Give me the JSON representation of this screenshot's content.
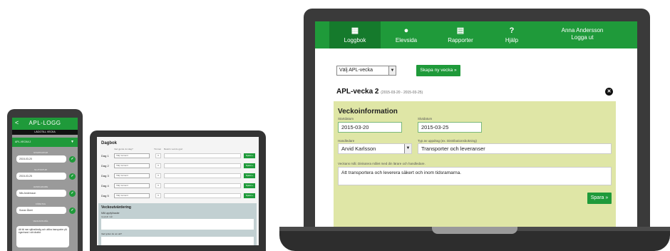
{
  "laptop": {
    "nav": [
      {
        "icon": "calendar-icon",
        "glyph": "▦",
        "label": "Loggbok"
      },
      {
        "icon": "user-icon",
        "glyph": "●",
        "label": "Elevsida"
      },
      {
        "icon": "report-icon",
        "glyph": "▤",
        "label": "Rapporter"
      },
      {
        "icon": "help-icon",
        "glyph": "?",
        "label": "Hjälp"
      }
    ],
    "user_name": "Anna Andersson",
    "logout": "Logga ut",
    "select_week": "Välj APL-vecka",
    "new_week_button": "Skapa ny vecka »",
    "week_title": "APL-vecka 2",
    "week_dates": "(2015-03-20 - 2015-03-25)",
    "panel_title": "Veckoinformation",
    "start_label": "Startdatum",
    "start_value": "2015-03-20",
    "end_label": "Slutdatum",
    "end_value": "2015-03-25",
    "supervisor_label": "Handledare",
    "supervisor_value": "Arvid Karlsson",
    "task_label": "Typ av uppdrag (ex. Distributionsbokning)",
    "task_value": "Transporter och leveranser",
    "goal_label": "Veckans mål. Diskutera målet med din lärare och handledare.",
    "goal_value": "Att transportera och leverera säkert och inom tidsramarna.",
    "save_button": "Spara »"
  },
  "tablet": {
    "title": "Dagbok",
    "col_moment": "Vad gjorde du idag?",
    "col_hours": "Timmar",
    "col_comment": "Beskriv vad du gjort",
    "rows": [
      {
        "day": "Dag 1",
        "select": "Välj moment",
        "num": "0",
        "button": "Spara »"
      },
      {
        "day": "Dag 2",
        "select": "Välj moment",
        "num": "0",
        "button": "Spara »"
      },
      {
        "day": "Dag 3",
        "select": "Välj moment",
        "num": "0",
        "button": "Spara »"
      },
      {
        "day": "Dag 4",
        "select": "Välj moment",
        "num": "0",
        "button": "Spara »"
      },
      {
        "day": "Dag 5",
        "select": "Välj moment",
        "num": "0",
        "button": "Spara »"
      }
    ],
    "eval_title": "Veckoutvärdering",
    "eval_q1": "Mål uppfyllnader",
    "eval_q1_sub": "Uppfyllt mål",
    "eval_q2": "Vad tycker du om att?"
  },
  "phone": {
    "title": "APL-LOGG",
    "subtitle": "LÄGGTILL VECKA",
    "week": "APL-VECKA 2",
    "start_label": "STARTDATUM",
    "start_value": "2015-03-20",
    "end_label": "SLUTDATUM",
    "end_value": "2015-03-25",
    "supervisor_label": "HANDLEDARE",
    "supervisor_value": "Nils Andersson",
    "place_label": "FÖRETAG",
    "place_value": "Sonax Åkeri",
    "goal_label": "VECKANS MÅL",
    "goal_value": "Att bli mer självständig och utföra transporter på egenhand i sitt distrikt."
  },
  "colors": {
    "brand_green": "#1f9a3a",
    "panel_yellow": "#dfe6a6",
    "panel_blue": "#c2d0d2"
  }
}
